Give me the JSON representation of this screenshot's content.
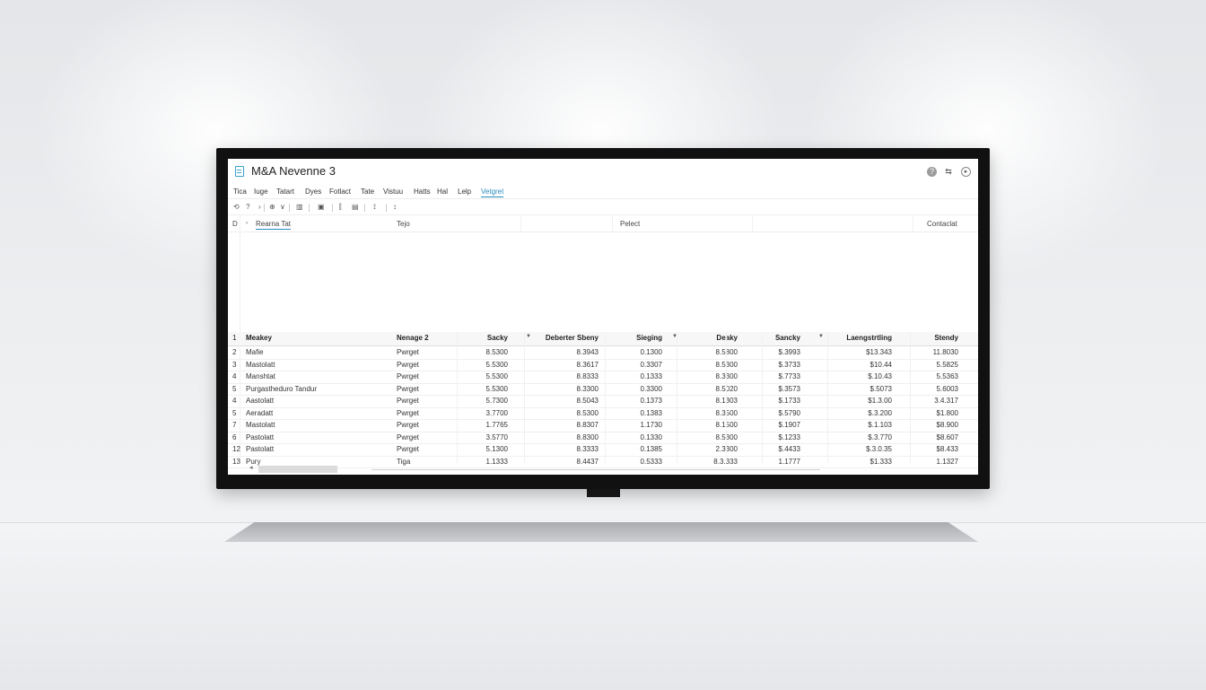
{
  "window": {
    "title": "M&A Nevenne 3",
    "controls": [
      "?",
      "⇆",
      "▸"
    ]
  },
  "menu": {
    "items": [
      "Tica",
      "Iuge",
      "Tatart",
      "Dyes",
      "Fotlact",
      "Tate",
      "Vistuu",
      "Hatts",
      "Hal",
      "Lelp",
      "Vetgret"
    ],
    "active_index": 10
  },
  "toolbar": {
    "icons": [
      "undo-icon",
      "help-icon",
      "dropdown-icon",
      "paste-icon",
      "chevron-down-icon",
      "grid-icon",
      "frame-icon",
      "align-icon",
      "image-icon",
      "filter-icon",
      "sort-icon"
    ],
    "glyphs": [
      "⟲",
      "?",
      "›",
      "⊕",
      "∨",
      "▥",
      "▣",
      "⫿",
      "▤",
      "⟟",
      "↕"
    ]
  },
  "header_row": {
    "row_num": "D",
    "tab_label": "Rearna Tat",
    "col_type": "Tejo",
    "col_pelect": "Pelect",
    "col_contact": "Contaclat"
  },
  "table": {
    "header_row_num": "1",
    "columns": [
      "Meakey",
      "Nenage 2",
      "Sacky",
      "Deberter Sbeny",
      "Sieging",
      "Deaky",
      "Sancky",
      "Laengstrtling",
      "Stendy"
    ],
    "rows": [
      {
        "num": "2",
        "cells": [
          "Mafie",
          "Pwrget",
          "8.5300",
          "8.3943",
          "0.1300",
          "8.5800",
          "$.3993",
          "$13.343",
          "11.8030"
        ]
      },
      {
        "num": "3",
        "cells": [
          "Mastolatt",
          "Pwrget",
          "5.5300",
          "8.3617",
          "0.3307",
          "8.5300",
          "$.3733",
          "$10.44",
          "5.5825"
        ]
      },
      {
        "num": "4",
        "cells": [
          "Manshtat",
          "Pwrget",
          "5.5300",
          "8.8333",
          "0.1333",
          "8.3300",
          "$.7733",
          "$.10.43",
          "5.5363"
        ]
      },
      {
        "num": "5",
        "cells": [
          "Purgastheduro Tandur",
          "Pwrget",
          "5.5300",
          "8.3300",
          "0.3300",
          "8.5020",
          "$.3573",
          "$.5073",
          "5.6003"
        ]
      },
      {
        "num": "4",
        "cells": [
          "Aastolatt",
          "Pwrget",
          "5.7300",
          "8.5043",
          "0.1373",
          "8.1303",
          "$.1733",
          "$1.3.00",
          "3.4.317"
        ]
      },
      {
        "num": "5",
        "cells": [
          "Aeradatt",
          "Pwrget",
          "3.7700",
          "8.5300",
          "0.1383",
          "8.3500",
          "$.5790",
          "$.3.200",
          "$1.800"
        ]
      },
      {
        "num": "7",
        "cells": [
          "Mastolatt",
          "Pwrget",
          "1.7765",
          "8.8307",
          "1.1730",
          "8.1500",
          "$.1907",
          "$.1.103",
          "$8.900"
        ]
      },
      {
        "num": "6",
        "cells": [
          "Pastolatt",
          "Pwrget",
          "3.5770",
          "8.8300",
          "0.1330",
          "8.5300",
          "$.1233",
          "$.3.770",
          "$8.607"
        ]
      },
      {
        "num": "12",
        "cells": [
          "Pastolatt",
          "Pwrget",
          "5.1300",
          "8.3333",
          "0.1385",
          "2.3300",
          "$.4433",
          "$.3.0.35",
          "$8.433"
        ]
      },
      {
        "num": "13",
        "cells": [
          "Pury",
          "Tiga",
          "1.1333",
          "8.4437",
          "0.5333",
          "8.3.333",
          "1.1777",
          "$1.333",
          "1.1327"
        ]
      }
    ]
  }
}
